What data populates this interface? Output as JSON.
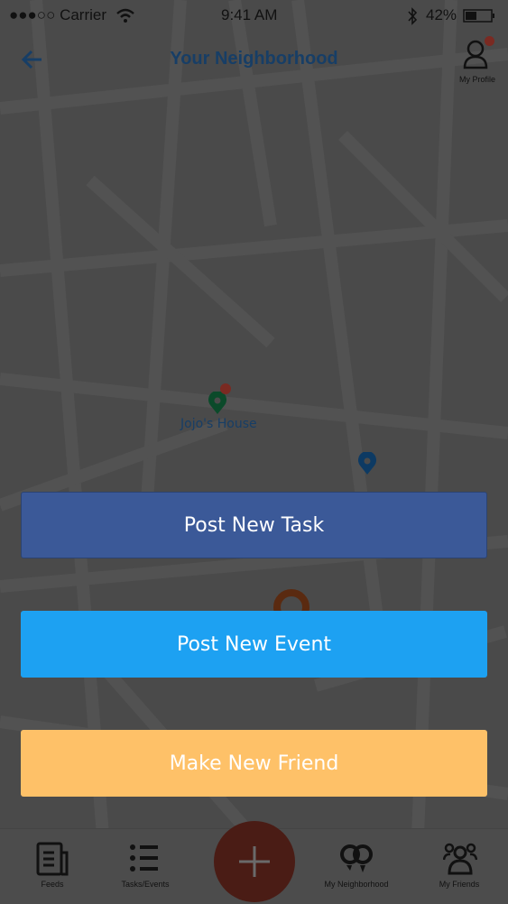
{
  "status_bar": {
    "carrier": "●●●○○ Carrier",
    "time": "9:41 AM",
    "battery": "42%",
    "battery_level": 0.42
  },
  "header": {
    "title": "Your Neighborhood",
    "profile_label": "My Profile"
  },
  "map": {
    "pin_label": "Jojo's House"
  },
  "actions": {
    "post_task": "Post New Task",
    "post_event": "Post New Event",
    "make_friend": "Make New Friend"
  },
  "colors": {
    "task": "#3b5998",
    "event": "#1da1f2",
    "friend": "#fec168",
    "fab": "#4a1c15",
    "title": "#173e66"
  },
  "tabs": [
    {
      "label": "Feeds",
      "icon": "newspaper-icon"
    },
    {
      "label": "Tasks/Events",
      "icon": "list-icon"
    },
    {
      "label": "My Neighborhood",
      "icon": "pins-icon"
    },
    {
      "label": "My Friends",
      "icon": "people-icon"
    }
  ]
}
